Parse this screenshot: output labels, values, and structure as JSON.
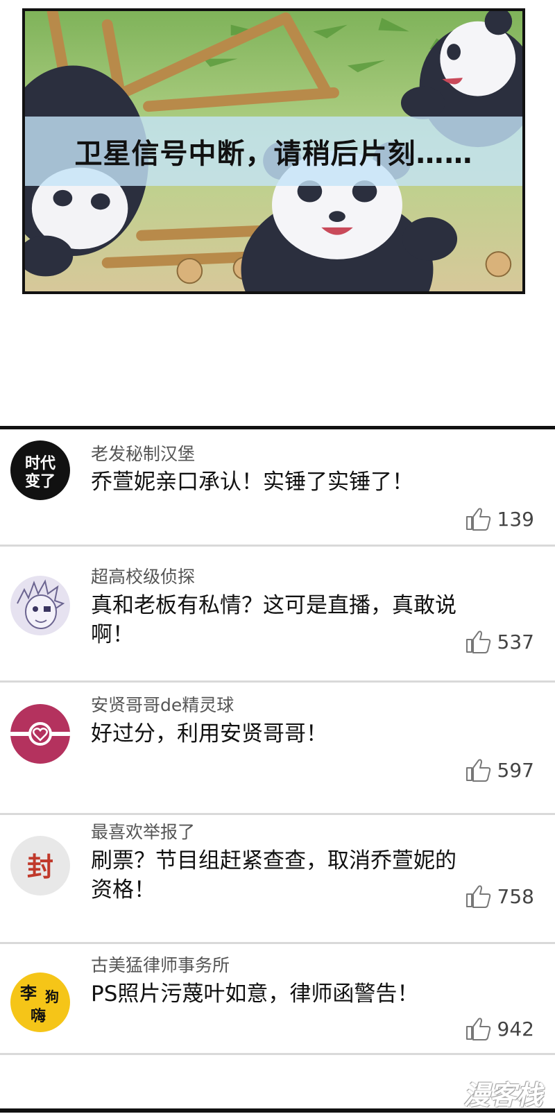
{
  "panel": {
    "banner_text": "卫星信号中断，请稍后片刻……"
  },
  "comments": [
    {
      "username": "老发秘制汉堡",
      "text": "乔萱妮亲口承认！实锤了实锤了！",
      "likes": "139",
      "avatar_text": "时代变了",
      "avatar_line1": "时代",
      "avatar_line2": "变了"
    },
    {
      "username": "超高校级侦探",
      "text": "真和老板有私情？这可是直播，真敢说啊！",
      "likes": "537"
    },
    {
      "username": "安贤哥哥de精灵球",
      "text": "好过分，利用安贤哥哥！",
      "likes": "597"
    },
    {
      "username": "最喜欢举报了",
      "text": "刷票？节目组赶紧查查，取消乔萱妮的资格！",
      "likes": "758",
      "avatar_text": "封"
    },
    {
      "username": "古美猛律师事务所",
      "text": "PS照片污蔑叶如意，律师函警告！",
      "likes": "942",
      "avatar_text": "李狗嗨",
      "avatar_line1": "李",
      "avatar_line2": "狗",
      "avatar_line3": "嗨"
    }
  ],
  "watermark": "漫客栈",
  "colors": {
    "banner_bg": "#c4e4f8",
    "avatar_dark": "#111111",
    "avatar_pokeball": "#b4325e",
    "avatar_seal_bg": "#e8e8e8",
    "avatar_seal_text": "#c0392b",
    "avatar_yellow": "#f5c518"
  }
}
